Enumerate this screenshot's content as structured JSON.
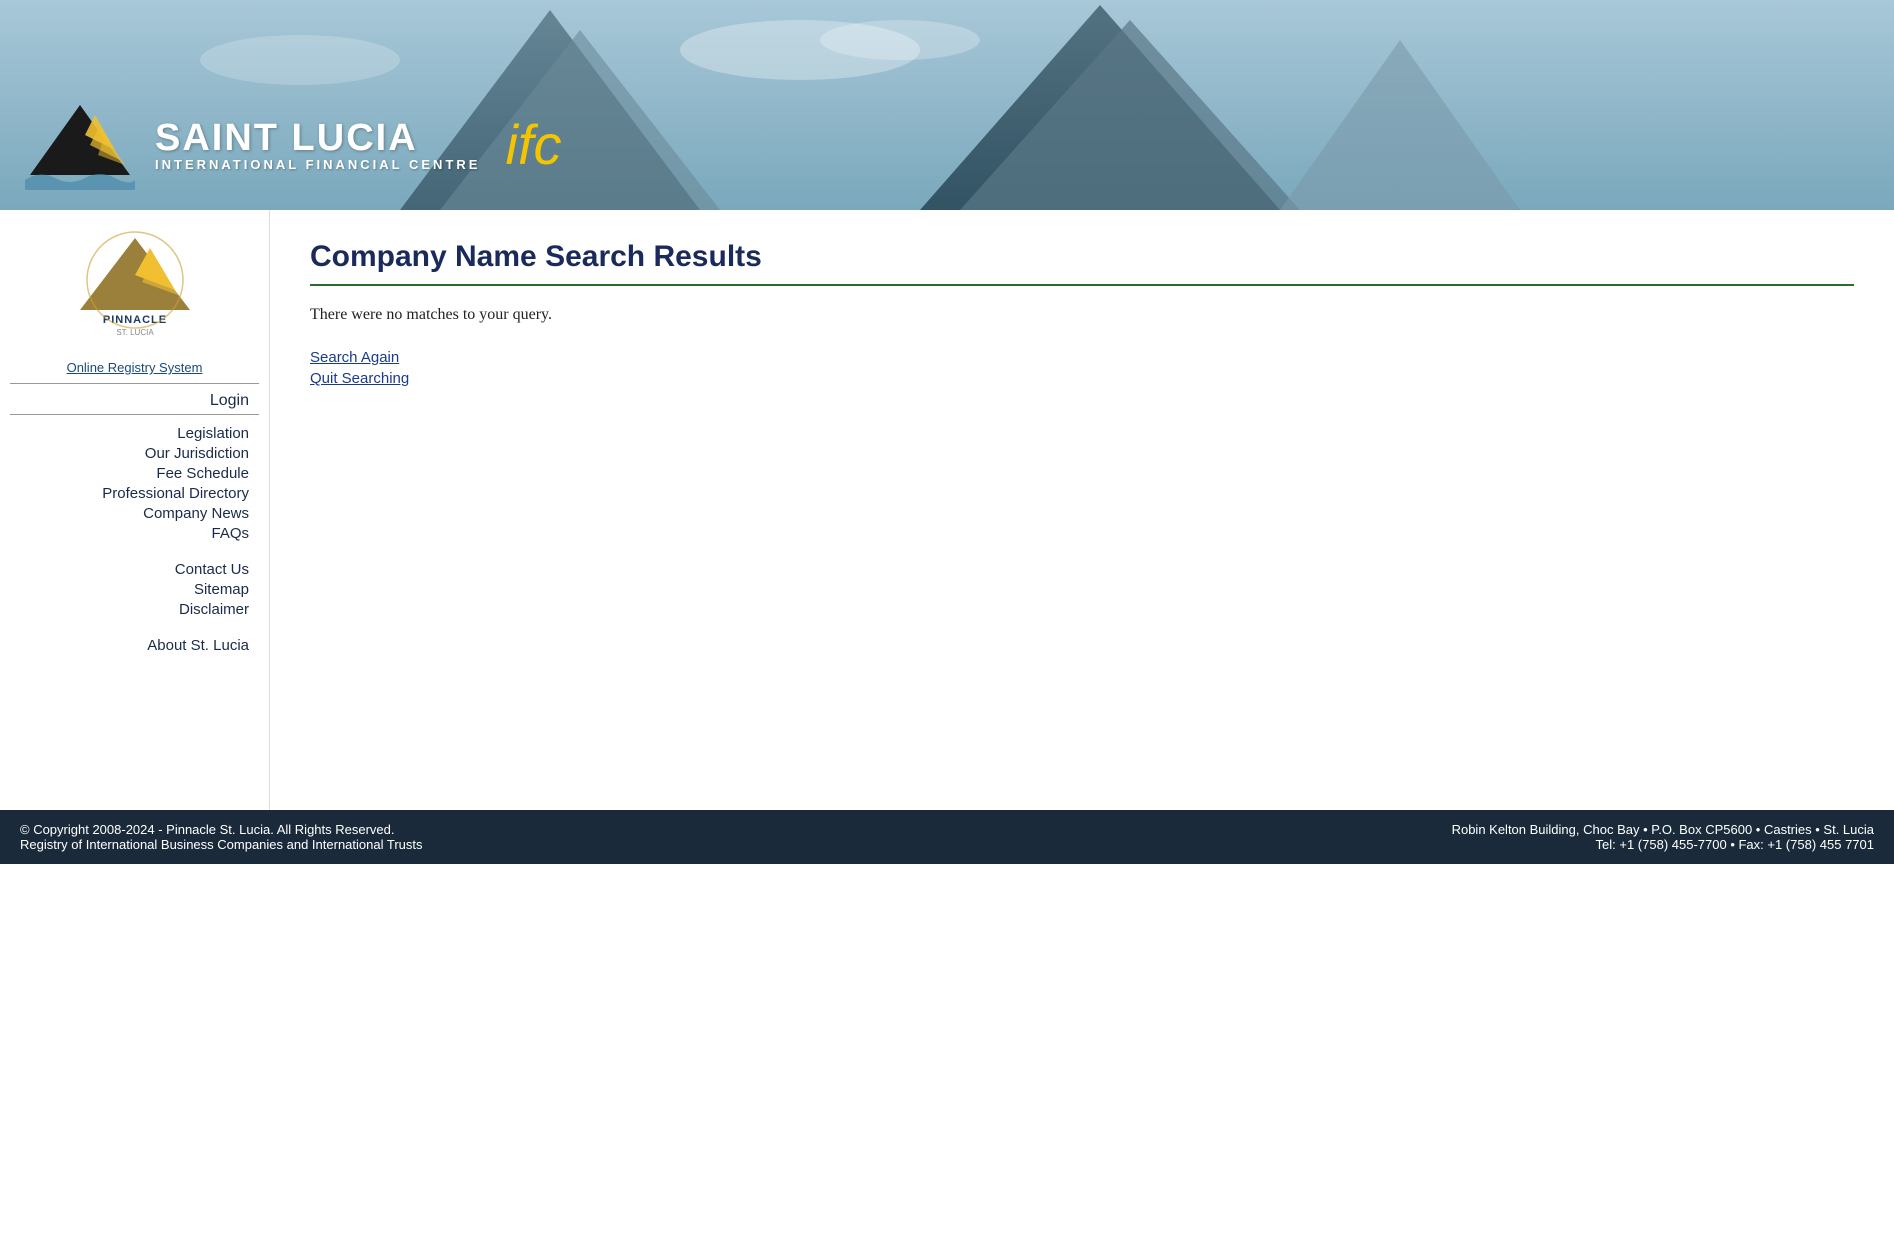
{
  "header": {
    "brand_name": "SAINT LUCIA",
    "brand_subtitle": "INTERNATIONAL FINANCIAL CENTRE",
    "ifc_label": "ifc"
  },
  "sidebar": {
    "online_registry_label": "Online Registry System",
    "login_label": "Login",
    "nav_items": [
      {
        "label": "Legislation",
        "href": "#"
      },
      {
        "label": "Our Jurisdiction",
        "href": "#"
      },
      {
        "label": "Fee Schedule",
        "href": "#"
      },
      {
        "label": "Professional Directory",
        "href": "#"
      },
      {
        "label": "Company News",
        "href": "#"
      },
      {
        "label": "FAQs",
        "href": "#"
      }
    ],
    "nav_items2": [
      {
        "label": "Contact Us",
        "href": "#"
      },
      {
        "label": "Sitemap",
        "href": "#"
      },
      {
        "label": "Disclaimer",
        "href": "#"
      }
    ],
    "nav_items3": [
      {
        "label": "About St. Lucia",
        "href": "#"
      }
    ]
  },
  "main": {
    "page_title": "Company Name Search Results",
    "no_matches_text": "There were no matches to your query.",
    "search_again_label": "Search Again",
    "quit_searching_label": "Quit Searching"
  },
  "footer": {
    "copyright_text": "© Copyright 2008-2024 - Pinnacle St. Lucia. All Rights Reserved.",
    "registry_text": "Registry of International Business Companies and International Trusts",
    "address_text": "Robin Kelton Building, Choc Bay • P.O. Box CP5600 • Castries • St. Lucia",
    "contact_text": "Tel: +1 (758) 455-7700 • Fax: +1 (758) 455 7701"
  }
}
